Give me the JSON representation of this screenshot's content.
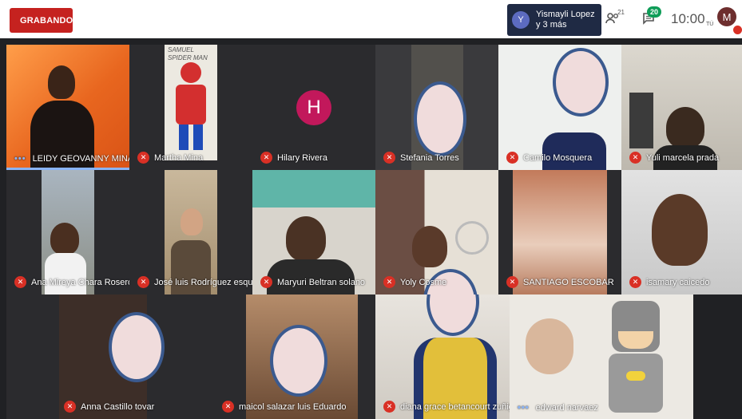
{
  "recording": {
    "label": "GRABANDO"
  },
  "presenter": {
    "initial": "Y",
    "line1": "Yismayli Lopez",
    "line2": "y 3 más"
  },
  "toolbar": {
    "people_count": "21",
    "chat_count": "20",
    "clock": "10:00",
    "self_initial": "M",
    "self_label": "TÚ"
  },
  "participants": [
    {
      "name": "LEIDY GEOVANNY MINA ROSAS",
      "muted": false,
      "active": true
    },
    {
      "name": "Martha Mina",
      "muted": true
    },
    {
      "name": "Hilary Rivera",
      "muted": true,
      "initial": "H"
    },
    {
      "name": "Stefania Torres",
      "muted": true
    },
    {
      "name": "Camilo Mosquera",
      "muted": true
    },
    {
      "name": "Yuli marcela prada",
      "muted": true
    },
    {
      "name": "Ana Mireya Chara Rosero",
      "muted": true
    },
    {
      "name": "José luis Rodríguez esquivel",
      "muted": true
    },
    {
      "name": "Maryuri Beltran solano",
      "muted": true
    },
    {
      "name": "Yoly Cosme",
      "muted": true
    },
    {
      "name": "SANTIAGO ESCOBAR",
      "muted": true
    },
    {
      "name": "isamary caicedo",
      "muted": true
    },
    {
      "name": "Anna Castillo tovar",
      "muted": true
    },
    {
      "name": "maicol salazar luis Eduardo",
      "muted": true
    },
    {
      "name": "diana grace betancourt zuñiga",
      "muted": true
    },
    {
      "name": "edward narvaez",
      "muted": false
    }
  ],
  "drawing_text": {
    "line1": "SAMUEL",
    "line2": "SPIDER MAN"
  },
  "icons": {
    "mic_off": "mic-off-icon",
    "people": "people-icon",
    "chat": "chat-icon"
  },
  "colors": {
    "record": "#c5221f",
    "mic_off": "#d93025",
    "avatar_h": "#c2185b",
    "blur_border": "#3b5a8f"
  }
}
